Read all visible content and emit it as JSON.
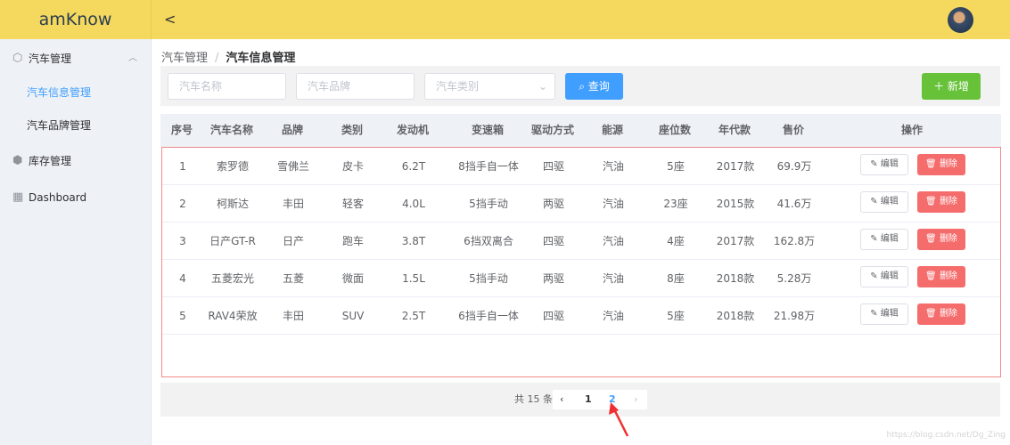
{
  "header": {
    "logo": "amKnow",
    "back": "<"
  },
  "sidebar": {
    "items": [
      {
        "label": "汽车管理",
        "icon": "cube-icon",
        "expanded": true
      },
      {
        "label": "汽车信息管理",
        "active": true
      },
      {
        "label": "汽车品牌管理"
      },
      {
        "label": "库存管理",
        "icon": "boxes-icon"
      },
      {
        "label": "Dashboard",
        "icon": "grid-icon"
      }
    ]
  },
  "breadcrumb": {
    "parent": "汽车管理",
    "sep": "/",
    "current": "汽车信息管理"
  },
  "search": {
    "name_placeholder": "汽车名称",
    "brand_placeholder": "汽车品牌",
    "type_placeholder": "汽车类别",
    "query_label": "查询",
    "add_label": "新增"
  },
  "table": {
    "columns": [
      "序号",
      "汽车名称",
      "品牌",
      "类别",
      "发动机",
      "变速箱",
      "驱动方式",
      "能源",
      "座位数",
      "年代款",
      "售价",
      "操作"
    ],
    "rows": [
      [
        "1",
        "索罗德",
        "雪佛兰",
        "皮卡",
        "6.2T",
        "8挡手自一体",
        "四驱",
        "汽油",
        "5座",
        "2017款",
        "69.9万"
      ],
      [
        "2",
        "柯斯达",
        "丰田",
        "轻客",
        "4.0L",
        "5挡手动",
        "两驱",
        "汽油",
        "23座",
        "2015款",
        "41.6万"
      ],
      [
        "3",
        "日产GT-R",
        "日产",
        "跑车",
        "3.8T",
        "6挡双离合",
        "四驱",
        "汽油",
        "4座",
        "2017款",
        "162.8万"
      ],
      [
        "4",
        "五菱宏光",
        "五菱",
        "微面",
        "1.5L",
        "5挡手动",
        "两驱",
        "汽油",
        "8座",
        "2018款",
        "5.28万"
      ],
      [
        "5",
        "RAV4荣放",
        "丰田",
        "SUV",
        "2.5T",
        "6挡手自一体",
        "四驱",
        "汽油",
        "5座",
        "2018款",
        "21.98万"
      ]
    ],
    "edit_label": "编辑",
    "delete_label": "删除"
  },
  "pagination": {
    "total": "共 15 条",
    "pages": [
      "1",
      "2"
    ],
    "current": "2",
    "prev": "‹",
    "next": "›"
  },
  "watermark": "https://blog.csdn.net/Dg_Zing",
  "colors": {
    "header": "#f4d95e",
    "primary": "#409eff",
    "success": "#67c23a",
    "danger": "#f56c6c"
  }
}
